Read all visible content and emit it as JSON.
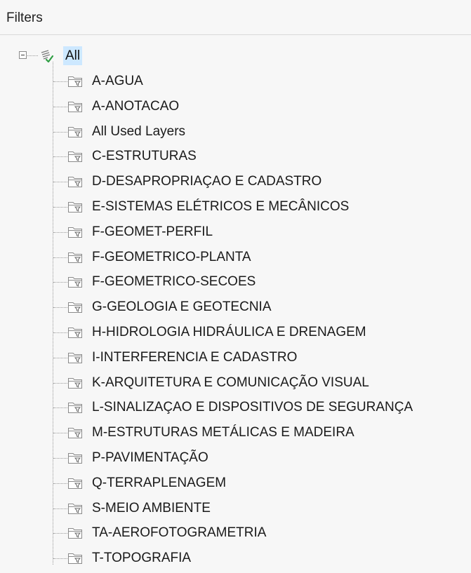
{
  "header": {
    "title": "Filters"
  },
  "tree": {
    "root": {
      "label": "All",
      "expanded": true,
      "selected": true,
      "icon": "filter-all-icon"
    },
    "items": [
      {
        "label": "A-AGUA"
      },
      {
        "label": "A-ANOTACAO"
      },
      {
        "label": "All Used Layers"
      },
      {
        "label": "C-ESTRUTURAS"
      },
      {
        "label": "D-DESAPROPRIAÇAO E CADASTRO"
      },
      {
        "label": "E-SISTEMAS ELÉTRICOS E MECÂNICOS"
      },
      {
        "label": "F-GEOMET-PERFIL"
      },
      {
        "label": "F-GEOMETRICO-PLANTA"
      },
      {
        "label": "F-GEOMETRICO-SECOES"
      },
      {
        "label": "G-GEOLOGIA E GEOTECNIA"
      },
      {
        "label": "H-HIDROLOGIA HIDRÁULICA E DRENAGEM"
      },
      {
        "label": "I-INTERFERENCIA E CADASTRO"
      },
      {
        "label": "K-ARQUITETURA E COMUNICAÇÃO VISUAL"
      },
      {
        "label": "L-SINALIZAÇAO E DISPOSITIVOS DE SEGURANÇA"
      },
      {
        "label": "M-ESTRUTURAS METÁLICAS E MADEIRA"
      },
      {
        "label": "P-PAVIMENTAÇÃO"
      },
      {
        "label": "Q-TERRAPLENAGEM"
      },
      {
        "label": "S-MEIO AMBIENTE"
      },
      {
        "label": "TA-AEROFOTOGRAMETRIA"
      },
      {
        "label": "T-TOPOGRAFIA"
      }
    ],
    "item_icon": "property-filter-folder-icon"
  },
  "colors": {
    "selection": "#cde8ff",
    "panel_bg": "#f7f7f7",
    "check_green": "#2f9e44"
  }
}
